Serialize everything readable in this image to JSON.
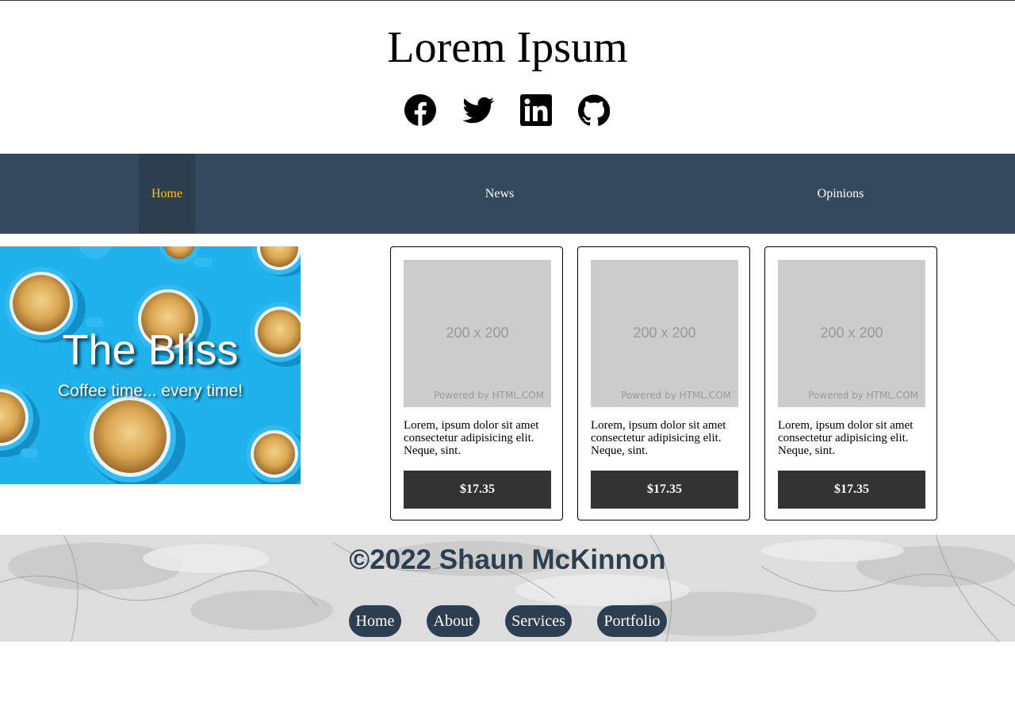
{
  "header": {
    "title": "Lorem Ipsum",
    "social_icons": [
      "facebook-icon",
      "twitter-icon",
      "linkedin-icon",
      "github-icon"
    ]
  },
  "nav": {
    "items": [
      {
        "label": "Home",
        "active": true
      },
      {
        "label": "News",
        "active": false
      },
      {
        "label": "Opinions",
        "active": false
      }
    ],
    "colors": {
      "bar": "#35495e",
      "active_bg": "#2c3e50",
      "active_text": "#f5c518"
    }
  },
  "hero": {
    "title": "The Bliss",
    "subtitle": "Coffee time... every time!"
  },
  "products": [
    {
      "placeholder_size": "200 x 200",
      "placeholder_credit": "Powered by HTML.COM",
      "description": "Lorem, ipsum dolor sit amet consectetur adipisicing elit. Neque, sint.",
      "price": "$17.35"
    },
    {
      "placeholder_size": "200 x 200",
      "placeholder_credit": "Powered by HTML.COM",
      "description": "Lorem, ipsum dolor sit amet consectetur adipisicing elit. Neque, sint.",
      "price": "$17.35"
    },
    {
      "placeholder_size": "200 x 200",
      "placeholder_credit": "Powered by HTML.COM",
      "description": "Lorem, ipsum dolor sit amet consectetur adipisicing elit. Neque, sint.",
      "price": "$17.35"
    }
  ],
  "footer": {
    "copyright": "©2022 Shaun McKinnon",
    "links": [
      "Home",
      "About",
      "Services",
      "Portfolio"
    ]
  }
}
